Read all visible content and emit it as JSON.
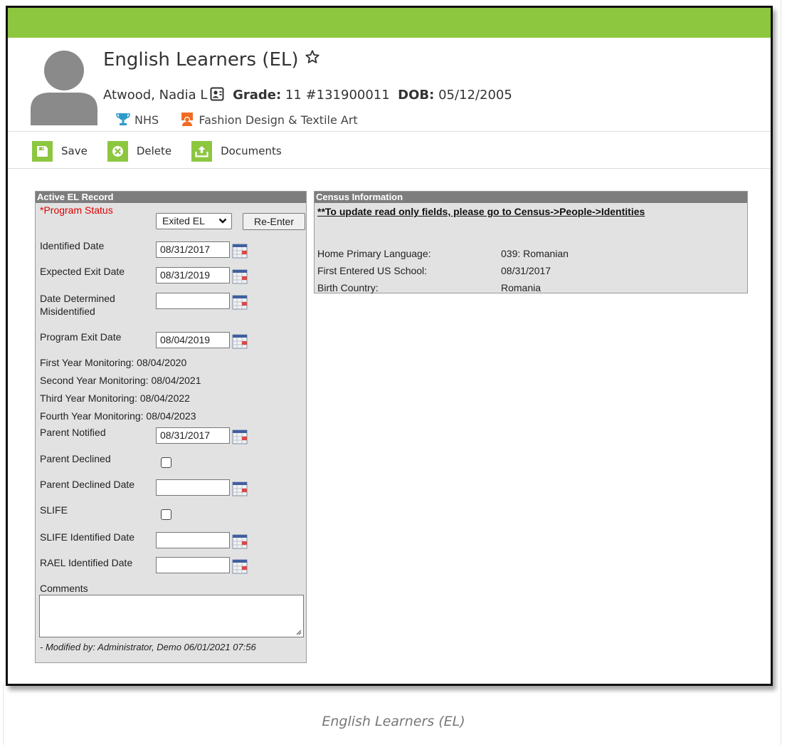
{
  "header": {
    "title": "English Learners (EL)",
    "student_name": "Atwood, Nadia L",
    "grade_label": "Grade:",
    "grade_value": "11 #131900011",
    "dob_label": "DOB:",
    "dob_value": "05/12/2005",
    "badges": [
      {
        "label": "NHS",
        "icon": "trophy-icon",
        "color": "#2e9cc9"
      },
      {
        "label": "Fashion Design & Textile Art",
        "icon": "teacher-icon",
        "color": "#f26b21"
      }
    ]
  },
  "toolbar": {
    "save_label": "Save",
    "delete_label": "Delete",
    "documents_label": "Documents",
    "accent": "#8dc63f"
  },
  "el_record": {
    "header": "Active EL Record",
    "program_status_label": "*Program Status",
    "program_status_value": "Exited EL",
    "reenter_label": "Re-Enter",
    "identified_date_label": "Identified Date",
    "identified_date": "08/31/2017",
    "expected_exit_label": "Expected Exit Date",
    "expected_exit": "08/31/2019",
    "misidentified_label_1": "Date Determined",
    "misidentified_label_2": "Misidentified",
    "misidentified_date": "",
    "program_exit_label": "Program Exit Date",
    "program_exit": "08/04/2019",
    "monitoring": [
      "First Year Monitoring: 08/04/2020",
      "Second Year Monitoring: 08/04/2021",
      "Third Year Monitoring: 08/04/2022",
      "Fourth Year Monitoring: 08/04/2023"
    ],
    "parent_notified_label": "Parent Notified",
    "parent_notified": "08/31/2017",
    "parent_declined_label": "Parent Declined",
    "parent_declined_checked": false,
    "parent_declined_date_label": "Parent Declined Date",
    "parent_declined_date": "",
    "slife_label": "SLIFE",
    "slife_checked": false,
    "slife_identified_label": "SLIFE Identified Date",
    "slife_identified_date": "",
    "rael_identified_label": "RAEL Identified Date",
    "rael_identified_date": "",
    "comments_label": "Comments",
    "comments_value": "",
    "modified_by": "- Modified by: Administrator, Demo 06/01/2021 07:56"
  },
  "census": {
    "header": "Census Information",
    "link": "**To update read only fields, please go to Census->People->Identities",
    "rows": [
      {
        "label": "Home Primary Language:",
        "value": "039: Romanian"
      },
      {
        "label": "First Entered US School:",
        "value": "08/31/2017"
      },
      {
        "label": "Birth Country:",
        "value": "Romania"
      }
    ]
  },
  "caption": "English Learners (EL)"
}
